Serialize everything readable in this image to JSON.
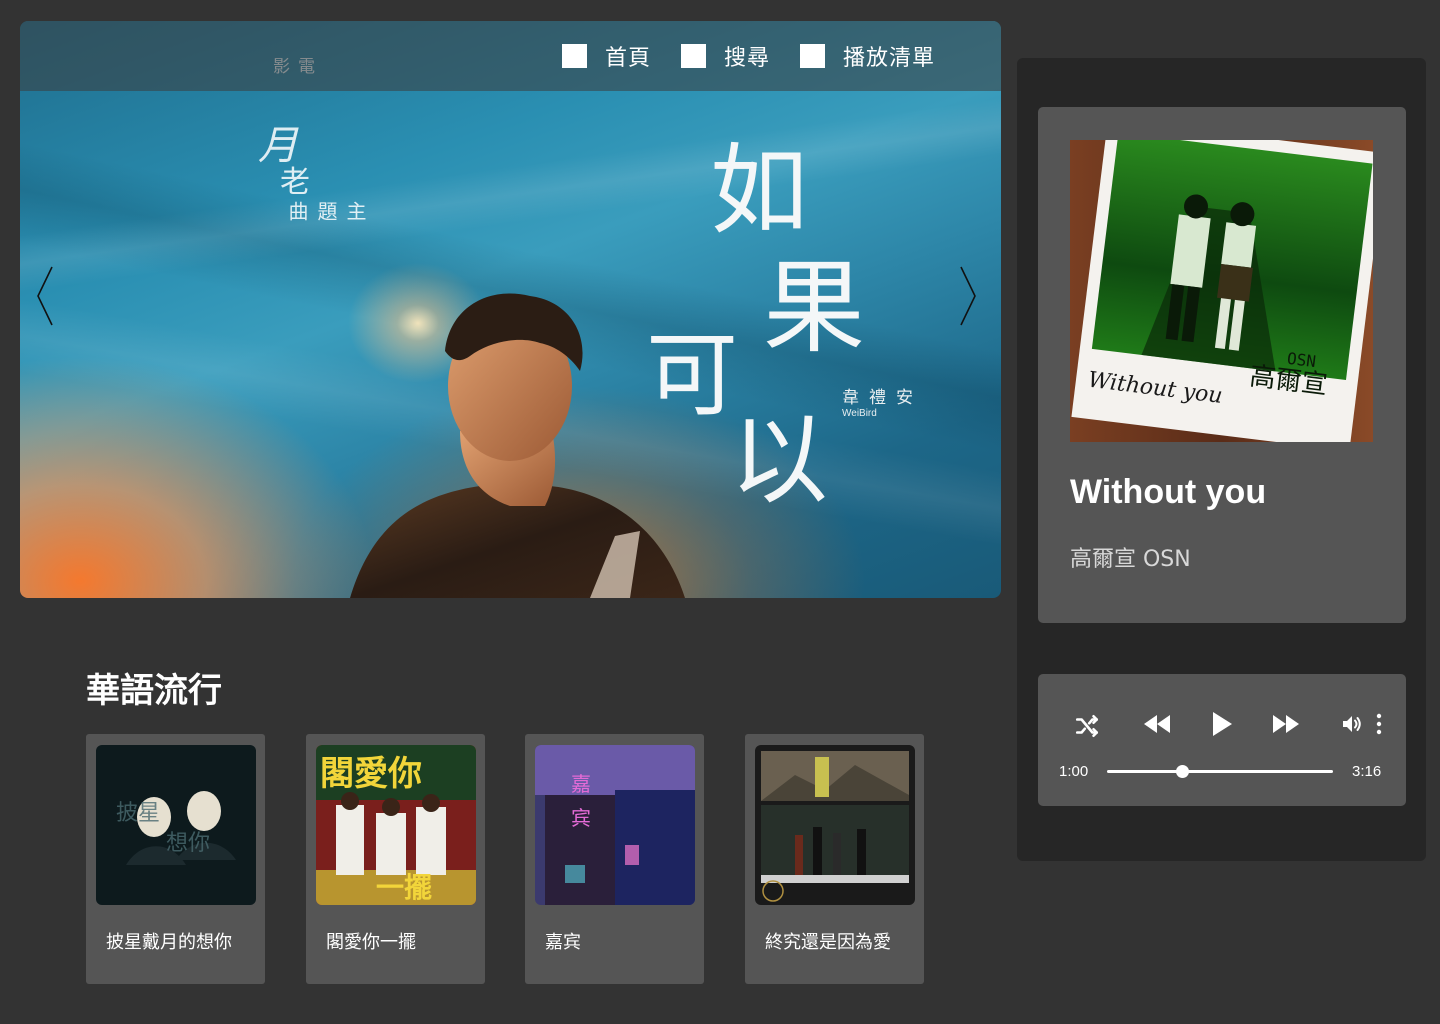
{
  "nav": {
    "items": [
      {
        "label": "首頁"
      },
      {
        "label": "搜尋"
      },
      {
        "label": "播放清單"
      }
    ]
  },
  "banner": {
    "movie_small": "電影",
    "movie_big": "月",
    "movie_big2": "老",
    "movie_sub": "主題曲",
    "song_chars": [
      "如",
      "果",
      "可",
      "以"
    ],
    "artist_cn": "韋禮安",
    "artist_en": "WeiBird",
    "prev_icon": "chevron-left-icon",
    "next_icon": "chevron-right-icon"
  },
  "section": {
    "title": "華語流行",
    "cards": [
      {
        "label": "披星戴月的想你"
      },
      {
        "label": "閣愛你一擺"
      },
      {
        "label": "嘉宾"
      },
      {
        "label": "終究還是因為愛"
      }
    ]
  },
  "now_playing": {
    "title": "Without you",
    "artist": "高爾宣 OSN",
    "cover_caption": "Without you",
    "cover_artist": "高爾宣",
    "cover_osn": "OSN"
  },
  "player": {
    "current_time": "1:00",
    "total_time": "3:16",
    "progress": 0.33,
    "icons": [
      "shuffle-icon",
      "rewind-icon",
      "play-icon",
      "fast-forward-icon",
      "volume-icon",
      "more-vertical-icon"
    ]
  },
  "colors": {
    "background": "#333333",
    "panel": "#262626",
    "card": "#555555",
    "text": "#ffffff"
  }
}
